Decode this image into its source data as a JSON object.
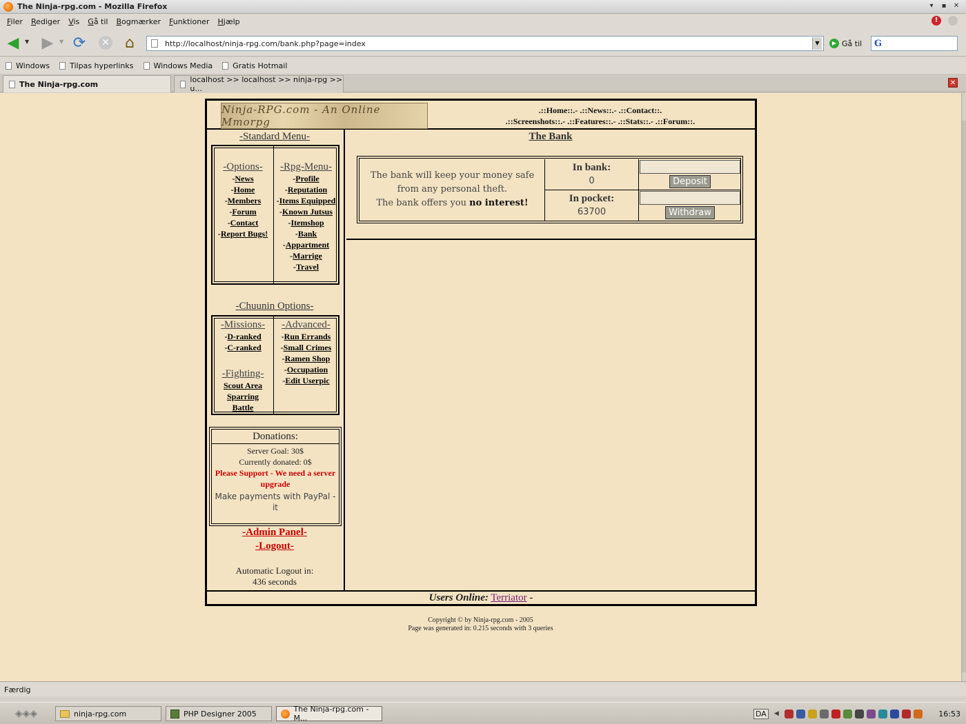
{
  "window": {
    "title": "The Ninja-rpg.com - Mozilla Firefox"
  },
  "menubar": [
    "Filer",
    "Rediger",
    "Vis",
    "Gå til",
    "Bogmærker",
    "Funktioner",
    "Hjælp"
  ],
  "navbar": {
    "url": "http://localhost/ninja-rpg.com/bank.php?page=index",
    "go_label": "Gå til",
    "search_engine": "G"
  },
  "bookmarks": [
    "Windows",
    "Tilpas hyperlinks",
    "Windows Media",
    "Gratis Hotmail"
  ],
  "tabs": [
    {
      "label": "The Ninja-rpg.com",
      "active": true
    },
    {
      "label": "localhost >> localhost >> ninja-rpg  >> u...",
      "active": false
    }
  ],
  "site": {
    "logo_text": "Ninja-RPG.com - An Online Mmorpg",
    "topnav": {
      "line1": ".::Home::.- .::News::.- .::Contact::.",
      "line2": ".::Screenshots::.- .::Features::.- .::Stats::.- .::Forum::."
    },
    "standard_menu_title": "-Standard Menu-",
    "options": {
      "heading": "-Options-",
      "items": [
        "News",
        "Home",
        "Members",
        "Forum",
        "Contact",
        "Report Bugs!"
      ]
    },
    "rpg_menu": {
      "heading": "-Rpg-Menu-",
      "items": [
        "Profile",
        "Reputation",
        "Items Equipped",
        "Known Jutsus",
        "Itemshop",
        "Bank",
        "Appartment",
        "Marrige",
        "Travel"
      ]
    },
    "chuunin_title": "-Chuunin Options-",
    "missions": {
      "heading": "-Missions-",
      "items": [
        "D-ranked",
        "C-ranked"
      ]
    },
    "fighting": {
      "heading": "-Fighting-",
      "items": [
        "Scout Area",
        "Sparring",
        "Battle"
      ]
    },
    "advanced": {
      "heading": "-Advanced-",
      "items": [
        "Run Errands",
        "Small Crimes",
        "Ramen Shop",
        "Occupation",
        "Edit Userpic"
      ]
    },
    "donations": {
      "title": "Donations:",
      "server_goal": "Server Goal: 30$",
      "donated": "Currently donated: 0$",
      "plea": "Please Support - We need a server upgrade",
      "paypal": "Make payments with PayPal - it"
    },
    "admin_link": "-Admin Panel-",
    "logout_link": "-Logout-",
    "autologout_label": "Automatic Logout in:",
    "autologout_value": "436 seconds",
    "bank": {
      "title": "The Bank",
      "desc_line1": "The bank will keep your money safe from any personal theft.",
      "desc_line2": "The bank offers you ",
      "desc_bold": "no interest!",
      "in_bank_label": "In bank:",
      "in_bank_value": "0",
      "in_pocket_label": "In pocket:",
      "in_pocket_value": "63700",
      "deposit_label": "Deposit",
      "withdraw_label": "Withdraw",
      "deposit_input": "",
      "withdraw_input": ""
    },
    "users_online_label": "Users Online:",
    "users_online_user": "Terriator",
    "users_online_suffix": " -",
    "copyright": "Copyright © by Ninja-rpg.com - 2005",
    "generated": "Page was generated in: 0.215 seconds with 3 queries"
  },
  "statusbar": {
    "text": "Færdig"
  },
  "taskbar": {
    "tasks": [
      "ninja-rpg.com",
      "PHP Designer 2005",
      "The Ninja-rpg.com - M..."
    ],
    "lang": "DA",
    "clock": "16:53"
  }
}
